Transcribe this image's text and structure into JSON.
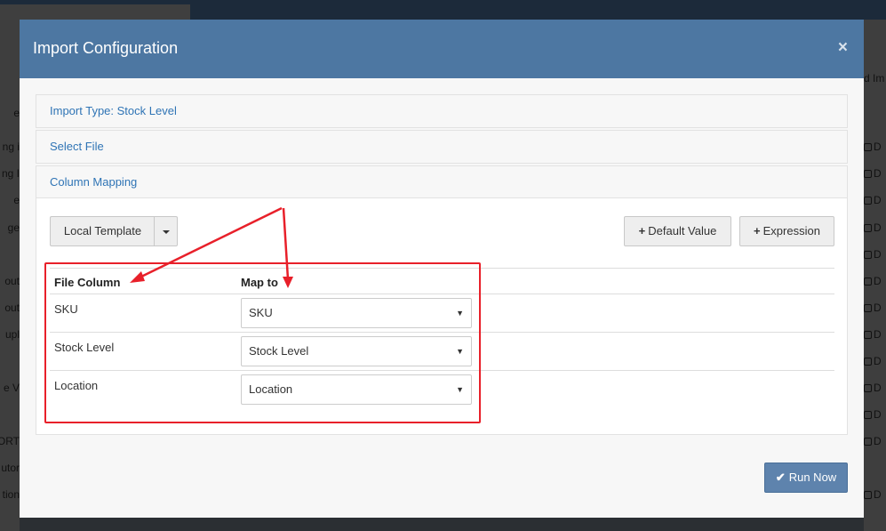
{
  "background": {
    "left_fragments": [
      "e",
      "ng i",
      "ng I",
      "e",
      "ge",
      "out",
      "out",
      "upl",
      "e V",
      "ORT",
      "utor",
      "tion"
    ],
    "right_fragments": [
      "d Im",
      "D",
      "D",
      "D",
      "D",
      "D",
      "D",
      "D",
      "D",
      "D",
      "D",
      "D",
      "D",
      "D"
    ]
  },
  "modal": {
    "title": "Import Configuration",
    "close_glyph": "×",
    "panels": {
      "import_type": "Import Type: Stock Level",
      "select_file": "Select File",
      "column_mapping": "Column Mapping"
    },
    "toolbar": {
      "template_label": "Local Template",
      "default_value_label": "Default Value",
      "expression_label": "Expression",
      "plus_glyph": "+"
    },
    "table": {
      "headers": {
        "file_column": "File Column",
        "map_to": "Map to"
      },
      "rows": [
        {
          "file_column": "SKU",
          "map_to": "SKU"
        },
        {
          "file_column": "Stock Level",
          "map_to": "Stock Level"
        },
        {
          "file_column": "Location",
          "map_to": "Location"
        }
      ],
      "select_arrow": "▼"
    },
    "footer": {
      "run_label": "Run Now",
      "check_glyph": "✔"
    }
  },
  "colors": {
    "header_bg": "#4d77a2",
    "link": "#2f74b5",
    "annotation_red": "#e8202a",
    "run_button": "#5e83ad"
  }
}
